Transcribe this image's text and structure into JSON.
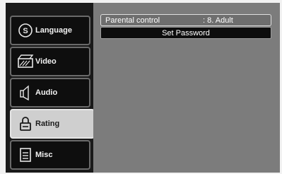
{
  "sidebar": {
    "items": [
      {
        "label": "Language",
        "icon": "language-icon",
        "selected": false
      },
      {
        "label": "Video",
        "icon": "video-icon",
        "selected": false
      },
      {
        "label": "Audio",
        "icon": "audio-icon",
        "selected": false
      },
      {
        "label": "Rating",
        "icon": "lock-icon",
        "selected": true
      },
      {
        "label": "Misc",
        "icon": "document-icon",
        "selected": false
      }
    ]
  },
  "main": {
    "parental_control": {
      "label": "Parental control",
      "value": ": 8. Adult"
    },
    "set_password": {
      "label": "Set Password"
    }
  },
  "colors": {
    "panel": "#7c7c7c",
    "item_bg": "#0e0e0e",
    "selected_bg": "#cfcfcf"
  }
}
